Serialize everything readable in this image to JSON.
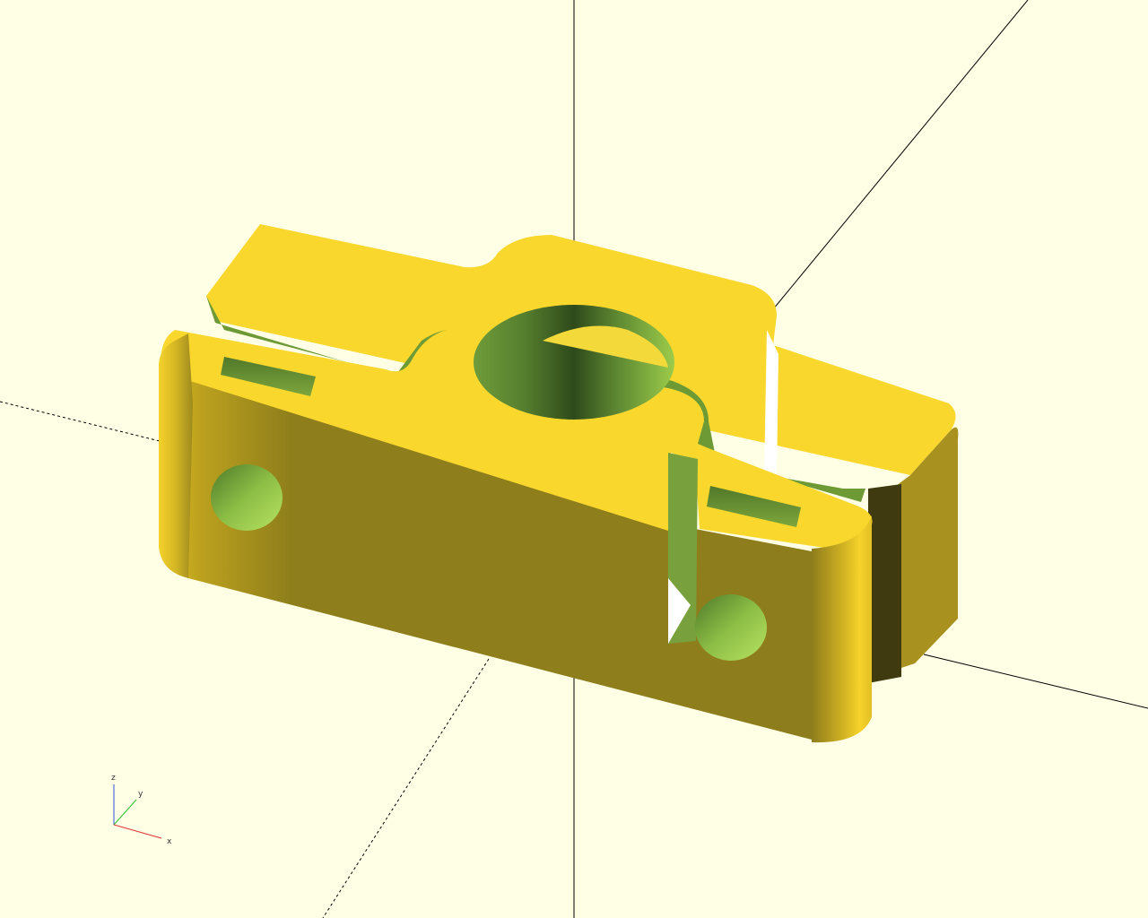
{
  "viewport": {
    "background": "#ffffe5",
    "model_color": "#f9d72c",
    "hole_color": "#9ed146"
  },
  "axis_gizmo": {
    "z_label": "z",
    "y_label": "y",
    "x_label": "x",
    "x_color": "#e03030",
    "y_color": "#30c030",
    "z_color": "#3050e0"
  }
}
